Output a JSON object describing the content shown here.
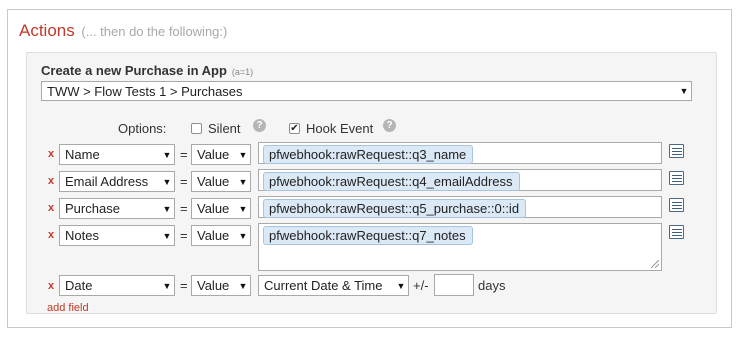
{
  "panel": {
    "title": "Actions",
    "subtitle": "(... then do the following:)"
  },
  "action": {
    "title": "Create a new Purchase in App",
    "annotation": "(a=1)",
    "target_select": "TWW > Flow Tests 1 > Purchases"
  },
  "options": {
    "label": "Options:",
    "silent": {
      "label": "Silent",
      "checked": false,
      "check_glyph": ""
    },
    "hook_event": {
      "label": "Hook Event",
      "checked": true,
      "check_glyph": "✔"
    },
    "help_glyph": "?"
  },
  "rows": [
    {
      "remove": "x",
      "field": "Name",
      "equals": "=",
      "type": "Value",
      "value": "pfwebhook:rawRequest::q3_name"
    },
    {
      "remove": "x",
      "field": "Email Address",
      "equals": "=",
      "type": "Value",
      "value": "pfwebhook:rawRequest::q4_emailAddress"
    },
    {
      "remove": "x",
      "field": "Purchase",
      "equals": "=",
      "type": "Value",
      "value": "pfwebhook:rawRequest::q5_purchase::0::id"
    },
    {
      "remove": "x",
      "field": "Notes",
      "equals": "=",
      "type": "Value",
      "value": "pfwebhook:rawRequest::q7_notes"
    }
  ],
  "date_row": {
    "remove": "x",
    "field": "Date",
    "equals": "=",
    "type": "Value",
    "date_value": "Current Date & Time",
    "offset_label": "+/-",
    "offset_value": "",
    "unit": "days"
  },
  "add_field": "add field",
  "icons": {
    "dropdown": "▼",
    "remove": "x",
    "list_picker": "list-picker-icon",
    "help": "help-icon",
    "resize": "resize-grip-icon"
  },
  "colors": {
    "accent_red": "#c0392b",
    "token_bg": "#dbe9f6",
    "token_border": "#a8c3de"
  }
}
